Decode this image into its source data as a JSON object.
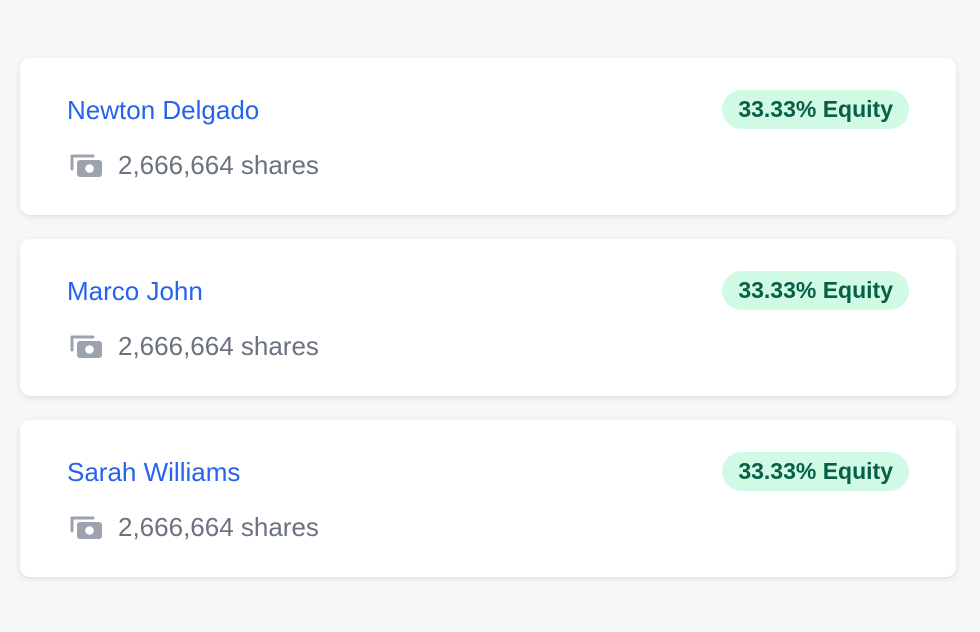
{
  "shareholders": [
    {
      "name": "Newton Delgado",
      "equity": "33.33% Equity",
      "shares": "2,666,664 shares",
      "icon": "money-bills-icon"
    },
    {
      "name": "Marco John",
      "equity": "33.33% Equity",
      "shares": "2,666,664 shares",
      "icon": "money-bills-icon"
    },
    {
      "name": "Sarah Williams",
      "equity": "33.33% Equity",
      "shares": "2,666,664 shares",
      "icon": "money-bills-icon"
    }
  ],
  "colors": {
    "background": "#f6f7f9",
    "card": "#ffffff",
    "name_link": "#2563eb",
    "badge_bg": "#d1fae5",
    "badge_text": "#065f46",
    "muted_text": "#6b7280",
    "icon": "#9ca3af"
  }
}
